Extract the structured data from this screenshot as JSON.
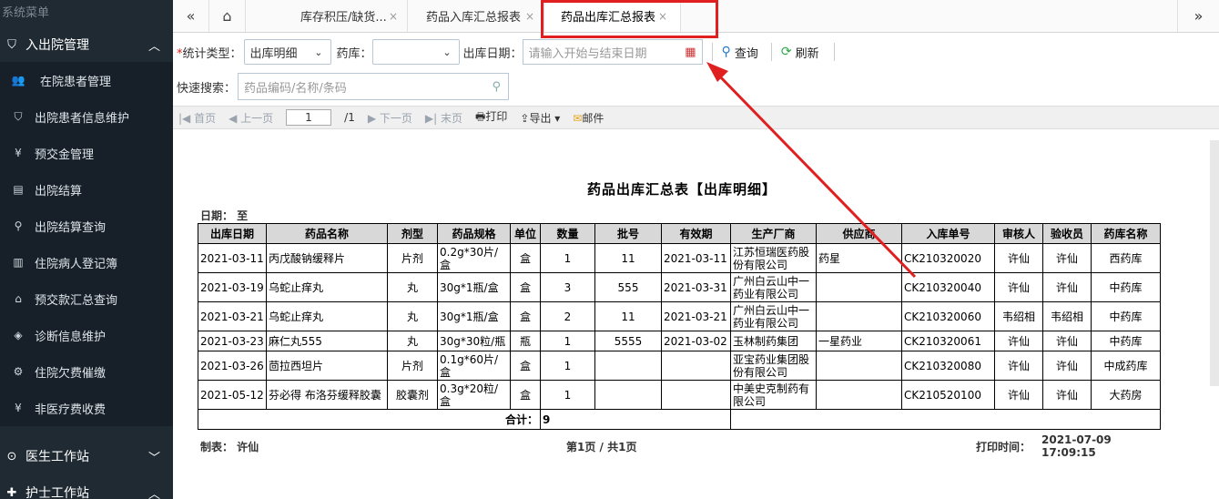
{
  "sidebar": {
    "title": "系统菜单",
    "group_inout": "入出院管理",
    "items": [
      {
        "label": "在院患者管理",
        "icon": "users-icon"
      },
      {
        "label": "出院患者信息维护",
        "icon": "shield-icon"
      },
      {
        "label": "预交金管理",
        "icon": "yen-icon"
      },
      {
        "label": "出院结算",
        "icon": "document-icon"
      },
      {
        "label": "出院结算查询",
        "icon": "search-icon"
      },
      {
        "label": "住院病人登记簿",
        "icon": "register-icon"
      },
      {
        "label": "预交款汇总查询",
        "icon": "home-icon"
      },
      {
        "label": "诊断信息维护",
        "icon": "layers-icon"
      },
      {
        "label": "住院欠费催缴",
        "icon": "gear-icon"
      },
      {
        "label": "非医疗费收费",
        "icon": "yen-icon"
      }
    ],
    "group_doctor": "医生工作站",
    "group_nurse": "护士工作站"
  },
  "tabs": {
    "items": [
      {
        "label": "库存积压/缺货..."
      },
      {
        "label": "药品入库汇总报表"
      },
      {
        "label": "药品出库汇总报表"
      }
    ],
    "close": "×"
  },
  "filter": {
    "type_label": "统计类型：",
    "type_value": "出库明细",
    "store_label": "药库：",
    "date_label": "出库日期：",
    "date_placeholder": "请输入开始与结束日期",
    "query": "查询",
    "refresh": "刷新",
    "search_label": "快速搜索：",
    "search_placeholder": "药品编码/名称/条码"
  },
  "pager": {
    "first": "首页",
    "prev": "上一页",
    "page": "1",
    "total": "/1",
    "next": "下一页",
    "last": "末页",
    "print": "打印",
    "export": "导出",
    "mail": "邮件"
  },
  "report": {
    "title": "药品出库汇总表【出库明细】",
    "date_line": "日期：   至",
    "headers": [
      "出库日期",
      "药品名称",
      "剂型",
      "药品规格",
      "单位",
      "数量",
      "批号",
      "有效期",
      "生产厂商",
      "供应商",
      "入库单号",
      "审核人",
      "验收员",
      "药库名称"
    ],
    "rows": [
      [
        "2021-03-11",
        "丙戊酸钠缓释片",
        "片剂",
        "0.2g*30片/盒",
        "盒",
        "1",
        "11",
        "2021-03-11",
        "江苏恒瑞医药股份有限公司",
        "药星",
        "CK210320020",
        "许仙",
        "许仙",
        "西药库"
      ],
      [
        "2021-03-19",
        "乌蛇止痒丸",
        "丸",
        "30g*1瓶/盒",
        "盒",
        "3",
        "555",
        "2021-03-31",
        "广州白云山中一药业有限公司",
        "",
        "CK210320040",
        "许仙",
        "许仙",
        "中药库"
      ],
      [
        "2021-03-21",
        "乌蛇止痒丸",
        "丸",
        "30g*1瓶/盒",
        "盒",
        "2",
        "11",
        "2021-03-21",
        "广州白云山中一药业有限公司",
        "",
        "CK210320060",
        "韦绍相",
        "韦绍相",
        "中药库"
      ],
      [
        "2021-03-23",
        "麻仁丸555",
        "丸",
        "30g*30粒/瓶",
        "瓶",
        "1",
        "5555",
        "2021-03-02",
        "玉林制药集团",
        "一星药业",
        "CK210320061",
        "许仙",
        "许仙",
        "中药库"
      ],
      [
        "2021-03-26",
        "茴拉西坦片",
        "片剂",
        "0.1g*60片/盒",
        "盒",
        "1",
        "",
        "",
        "亚宝药业集团股份有限公司",
        "",
        "CK210320080",
        "许仙",
        "许仙",
        "中成药库"
      ],
      [
        "2021-05-12",
        "芬必得 布洛芬缓释胶囊",
        "胶囊剂",
        "0.3g*20粒/盒",
        "盒",
        "1",
        "",
        "",
        "中美史克制药有限公司",
        "",
        "CK210520100",
        "许仙",
        "许仙",
        "大药房"
      ]
    ],
    "total_label": "合计：",
    "total_value": "9",
    "maker": "制表：   许仙",
    "page_info": "第1页 / 共1页",
    "print_time_label": "打印时间：",
    "print_date": "2021-07-09",
    "print_clock": "17:09:15"
  }
}
